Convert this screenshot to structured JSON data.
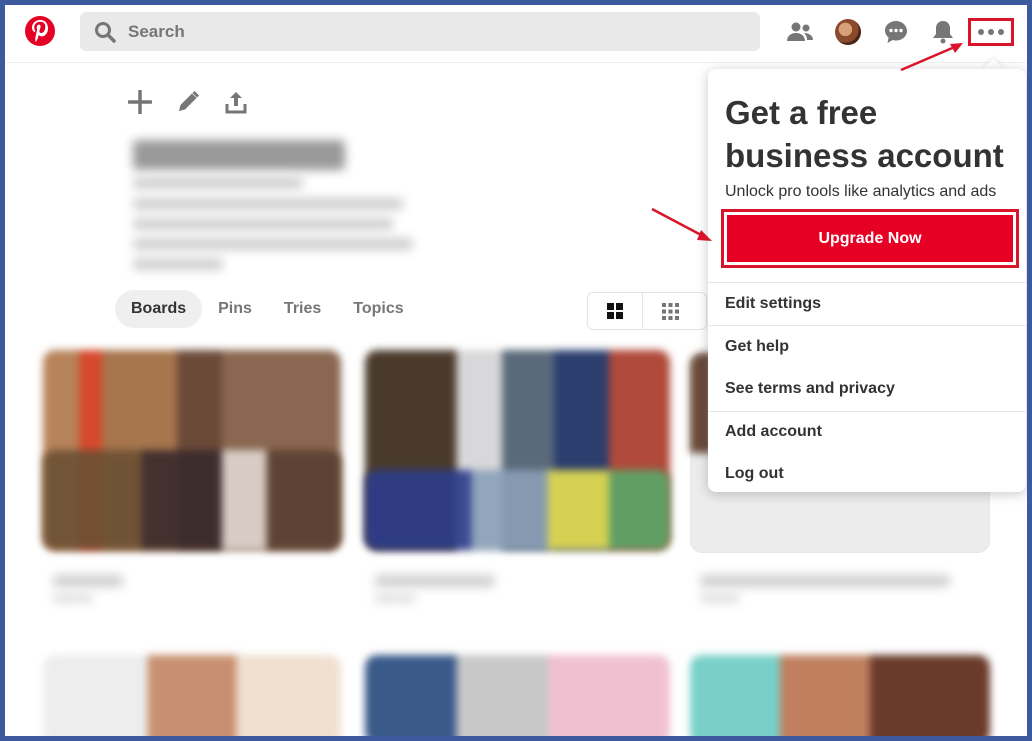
{
  "header": {
    "logo": "pinterest-logo",
    "search": {
      "placeholder": "Search",
      "value": ""
    },
    "icons": [
      "people-icon",
      "avatar",
      "chat-icon",
      "bell-icon",
      "more-icon"
    ]
  },
  "profile_tools": [
    "plus-icon",
    "pencil-icon",
    "share-icon"
  ],
  "tabs": [
    {
      "label": "Boards",
      "active": true
    },
    {
      "label": "Pins",
      "active": false
    },
    {
      "label": "Tries",
      "active": false
    },
    {
      "label": "Topics",
      "active": false
    }
  ],
  "view_toggle": [
    "grid-large-icon",
    "grid-small-icon"
  ],
  "dropdown": {
    "promo_title": "Get a free business account",
    "promo_subtitle": "Unlock pro tools like analytics and ads",
    "upgrade_label": "Upgrade Now",
    "items": [
      "Edit settings",
      "Get help",
      "See terms and privacy",
      "Add account",
      "Log out"
    ]
  },
  "colors": {
    "brand": "#e60023",
    "highlight": "#d9142b",
    "frame": "#3d5a9e",
    "text": "#333333",
    "muted": "#767676"
  }
}
